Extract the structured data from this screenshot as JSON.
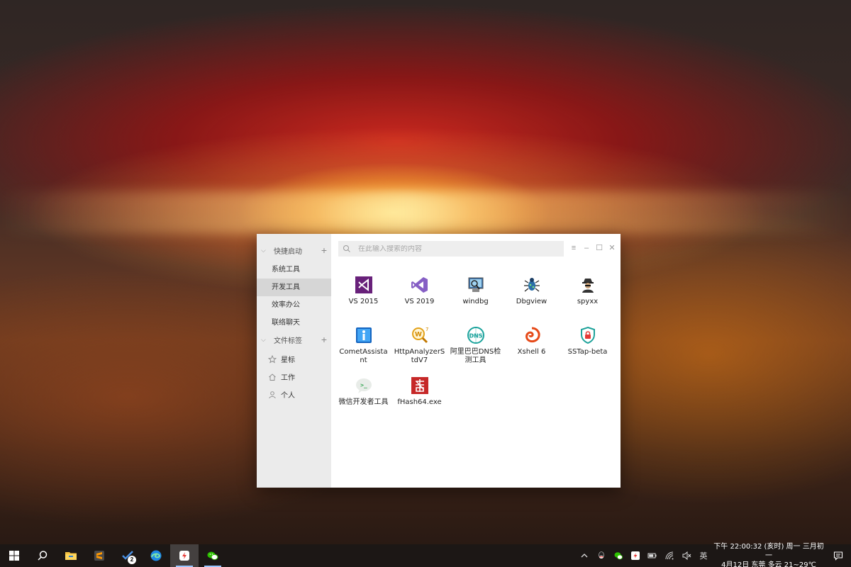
{
  "launcher": {
    "search_placeholder": "在此输入搜索的内容",
    "window_controls": {
      "menu": "≡",
      "minimize": "–",
      "maximize": "☐",
      "close": "✕"
    },
    "groups": [
      {
        "title": "快捷启动",
        "items": [
          "系统工具",
          "开发工具",
          "效率办公",
          "联络聊天"
        ],
        "active": "开发工具"
      },
      {
        "title": "文件标签",
        "items": [
          {
            "label": "星标",
            "icon": "star-icon"
          },
          {
            "label": "工作",
            "icon": "home-icon"
          },
          {
            "label": "个人",
            "icon": "person-icon"
          }
        ]
      }
    ],
    "apps": [
      {
        "label": "VS 2015",
        "icon": "visual-studio-2015-icon"
      },
      {
        "label": "VS 2019",
        "icon": "visual-studio-2019-icon"
      },
      {
        "label": "windbg",
        "icon": "windbg-icon"
      },
      {
        "label": "Dbgview",
        "icon": "dbgview-icon"
      },
      {
        "label": "spyxx",
        "icon": "spyxx-icon"
      },
      {
        "label": "CometAssistant",
        "icon": "comet-assistant-icon"
      },
      {
        "label": "HttpAnalyzerStdV7",
        "icon": "http-analyzer-icon"
      },
      {
        "label": "阿里巴巴DNS检测工具",
        "icon": "alibaba-dns-icon"
      },
      {
        "label": "Xshell 6",
        "icon": "xshell-icon"
      },
      {
        "label": "SSTap-beta",
        "icon": "sstap-icon"
      },
      {
        "label": "微信开发者工具",
        "icon": "wechat-devtools-icon"
      },
      {
        "label": "fHash64.exe",
        "icon": "fhash-icon"
      }
    ]
  },
  "taskbar": {
    "apps": [
      {
        "name": "start",
        "icon": "windows-start-icon"
      },
      {
        "name": "search",
        "icon": "search-icon"
      },
      {
        "name": "file-explorer",
        "icon": "folder-icon"
      },
      {
        "name": "sublime-text",
        "icon": "sublime-icon"
      },
      {
        "name": "todo",
        "icon": "todo-icon",
        "badge": "2"
      },
      {
        "name": "edge",
        "icon": "edge-icon"
      },
      {
        "name": "launcher",
        "icon": "launcher-icon",
        "active": true
      },
      {
        "name": "wechat",
        "icon": "wechat-icon"
      }
    ],
    "tray": {
      "ime": "英",
      "clock_line1": "下午 22:00:32 (亥时) 周一 三月初一",
      "clock_line2": "4月12日 东莞 多云 21~29℃"
    }
  }
}
